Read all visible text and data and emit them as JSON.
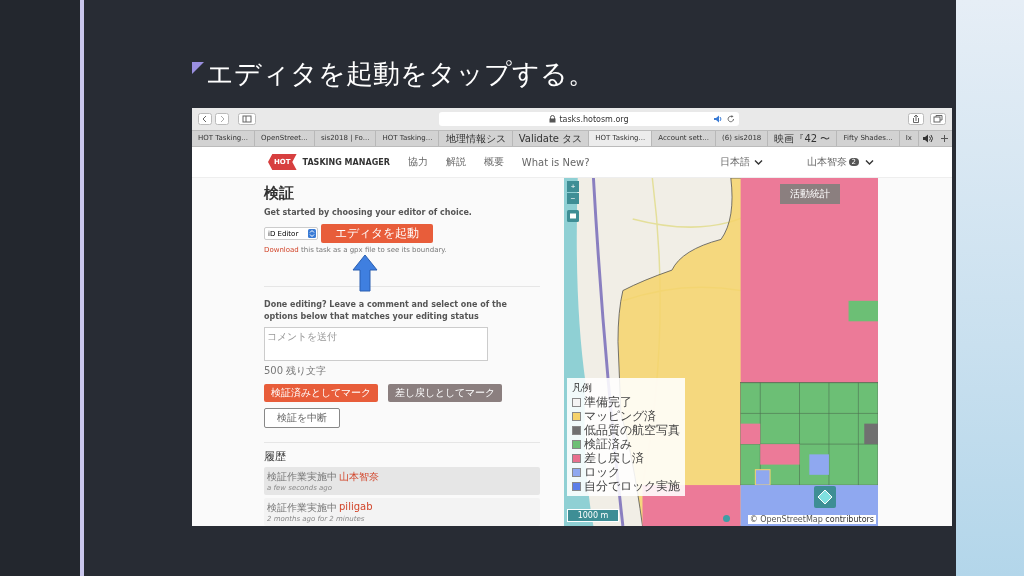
{
  "slide": {
    "title": "エディタを起動をタップする。"
  },
  "browser": {
    "url": "tasks.hotosm.org",
    "tabs": [
      {
        "label": "HOT Tasking...",
        "selected": false
      },
      {
        "label": "OpenStreet...",
        "selected": false
      },
      {
        "label": "sis2018 | Fo...",
        "selected": false
      },
      {
        "label": "HOT Tasking...",
        "selected": false
      },
      {
        "label": "地理情報シス",
        "selected": false
      },
      {
        "label": "Validate タス",
        "selected": false
      },
      {
        "label": "HOT Tasking...",
        "selected": true
      },
      {
        "label": "Account sett...",
        "selected": false
      },
      {
        "label": "(6) sis2018",
        "selected": false
      },
      {
        "label": "映画『42 〜",
        "selected": false
      },
      {
        "label": "Fifty Shades...",
        "selected": false
      },
      {
        "label": "Ix",
        "selected": false
      }
    ]
  },
  "navbar": {
    "logo_badge": "HOT",
    "logo_text": "TASKING MANAGER",
    "links": [
      "協力",
      "解説",
      "概要",
      "What is New?"
    ],
    "language": "日本語",
    "user": "山本智奈",
    "user_badge": "2"
  },
  "panel": {
    "heading": "検証",
    "intro": "Get started by choosing your editor of choice.",
    "editor_select": "iD Editor",
    "start_button": "エディタを起動",
    "download_link": "Download",
    "download_text": " this task as a gpx file to see its boundary.",
    "done_text": "Done editing? Leave a comment and select one of the options below that matches your editing status",
    "comment_placeholder": "コメントを送付",
    "char_count": "500 残り文字",
    "buttons": [
      {
        "label": "検証済みとしてマーク",
        "kind": "primary"
      },
      {
        "label": "差し戻しとしてマーク",
        "kind": "secondary"
      },
      {
        "label": "検証を中断",
        "kind": "outline"
      }
    ],
    "history_heading": "履歴",
    "history": [
      {
        "action": "検証作業実施中",
        "user": "山本智奈",
        "time": "a few seconds ago",
        "highlighted": true
      },
      {
        "action": "検証作業実施中",
        "user": "piligab",
        "time": "2 months ago for 2 minutes",
        "highlighted": false
      }
    ]
  },
  "map": {
    "stats_button": "活動統計",
    "zoom_in": "+",
    "zoom_out": "−",
    "legend_title": "凡例",
    "legend": [
      {
        "label": "準備完了",
        "color": "#f4f4f4"
      },
      {
        "label": "マッピング済",
        "color": "#f6d36b"
      },
      {
        "label": "低品質の航空写真",
        "color": "#707070"
      },
      {
        "label": "検証済み",
        "color": "#6cbf75"
      },
      {
        "label": "差し戻し済",
        "color": "#e8708e"
      },
      {
        "label": "ロック",
        "color": "#8fa8f0"
      },
      {
        "label": "自分でロック実施",
        "color": "#5a7ee8"
      }
    ],
    "scale": "1000 m",
    "attribution": "© OpenStreetMap ",
    "attribution_link": "contributors"
  }
}
